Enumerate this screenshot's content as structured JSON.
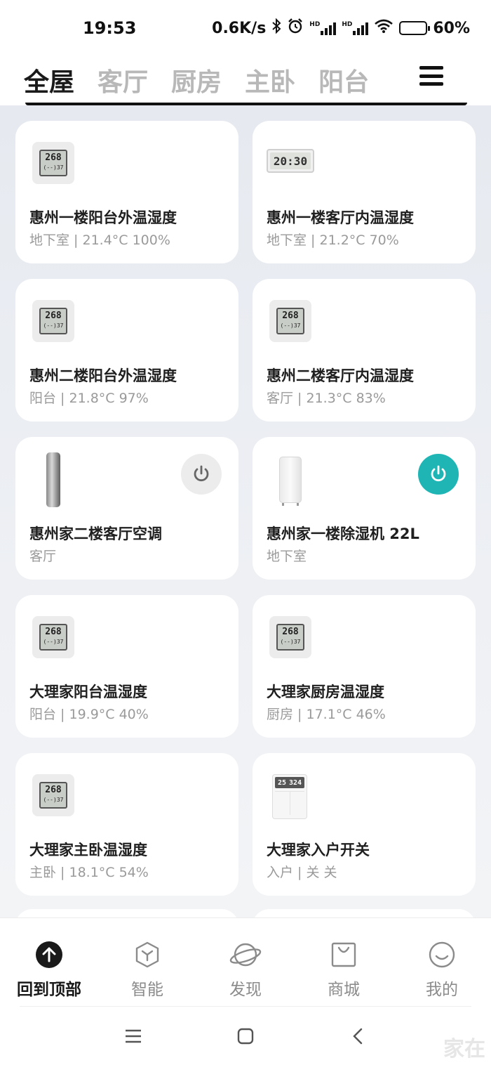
{
  "status_bar": {
    "time": "19:53",
    "net_speed": "0.6K/s",
    "battery": "60%",
    "battery_level": 0.6,
    "sim1": "HD",
    "sim2": "HD"
  },
  "room_tabs": [
    {
      "label": "全屋",
      "active": true
    },
    {
      "label": "客厅",
      "active": false
    },
    {
      "label": "厨房",
      "active": false
    },
    {
      "label": "主卧",
      "active": false
    },
    {
      "label": "阳台",
      "active": false
    }
  ],
  "devices": [
    {
      "name": "惠州一楼阳台外温湿度",
      "status": "地下室 | 21.4°C 100%",
      "image": "thermo-hygrometer-icon",
      "lcd_main": "268",
      "lcd_sub": "(--)37"
    },
    {
      "name": "惠州一楼客厅内温湿度",
      "status": "地下室 | 21.2°C 70%",
      "image": "clock-thermometer-icon",
      "lcd_main": "20:30"
    },
    {
      "name": "惠州二楼阳台外温湿度",
      "status": "阳台 | 21.8°C 97%",
      "image": "thermo-hygrometer-icon",
      "lcd_main": "268",
      "lcd_sub": "(--)37"
    },
    {
      "name": "惠州二楼客厅内温湿度",
      "status": "客厅 | 21.3°C 83%",
      "image": "thermo-hygrometer-icon",
      "lcd_main": "268",
      "lcd_sub": "(--)37"
    },
    {
      "name": "惠州家二楼客厅空调",
      "status": "客厅",
      "image": "air-conditioner-icon",
      "power": "off"
    },
    {
      "name": "惠州家一楼除湿机 22L",
      "status": "地下室",
      "image": "dehumidifier-icon",
      "power": "on"
    },
    {
      "name": "大理家阳台温湿度",
      "status": "阳台 | 19.9°C 40%",
      "image": "thermo-hygrometer-icon",
      "lcd_main": "268",
      "lcd_sub": "(--)37"
    },
    {
      "name": "大理家厨房温湿度",
      "status": "厨房 | 17.1°C 46%",
      "image": "thermo-hygrometer-icon",
      "lcd_main": "268",
      "lcd_sub": "(--)37"
    },
    {
      "name": "大理家主卧温湿度",
      "status": "主卧 | 18.1°C 54%",
      "image": "thermo-hygrometer-icon",
      "lcd_main": "268",
      "lcd_sub": "(--)37"
    },
    {
      "name": "大理家入户开关",
      "status": "入户 | 关 关",
      "image": "wall-switch-icon",
      "lcd_left": "25",
      "lcd_right": "324"
    }
  ],
  "bottom_nav": [
    {
      "label": "回到顶部",
      "icon": "arrow-up-circle-icon",
      "active": true
    },
    {
      "label": "智能",
      "icon": "cube-icon",
      "active": false
    },
    {
      "label": "发现",
      "icon": "planet-icon",
      "active": false
    },
    {
      "label": "商城",
      "icon": "shopping-bag-icon",
      "active": false
    },
    {
      "label": "我的",
      "icon": "smiley-icon",
      "active": false
    }
  ],
  "watermark": "家在",
  "colors": {
    "power_on": "#1fb5b5",
    "power_off": "#ececec",
    "active_text": "#1a1a1a",
    "inactive_text": "#b8b8b8"
  }
}
